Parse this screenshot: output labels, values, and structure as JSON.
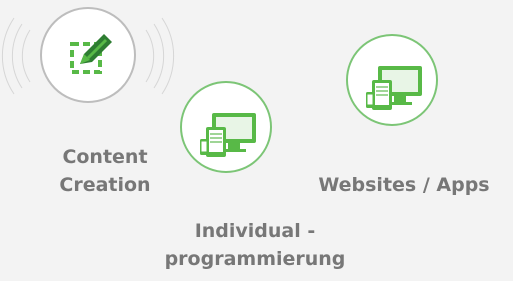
{
  "services": [
    {
      "title_line1": "Content",
      "title_line2": "Creation",
      "icon": "edit-select-icon"
    },
    {
      "title_line1": "Individual -",
      "title_line2": "programmierung",
      "icon": "responsive-devices-icon"
    },
    {
      "title": "Websites / Apps",
      "icon": "responsive-devices-icon"
    }
  ],
  "colors": {
    "accent_green": "#58b947",
    "dark_green": "#2e7d32",
    "label_gray": "#777777",
    "ring_gray": "#bdbdbd",
    "background": "#f3f3f3"
  }
}
